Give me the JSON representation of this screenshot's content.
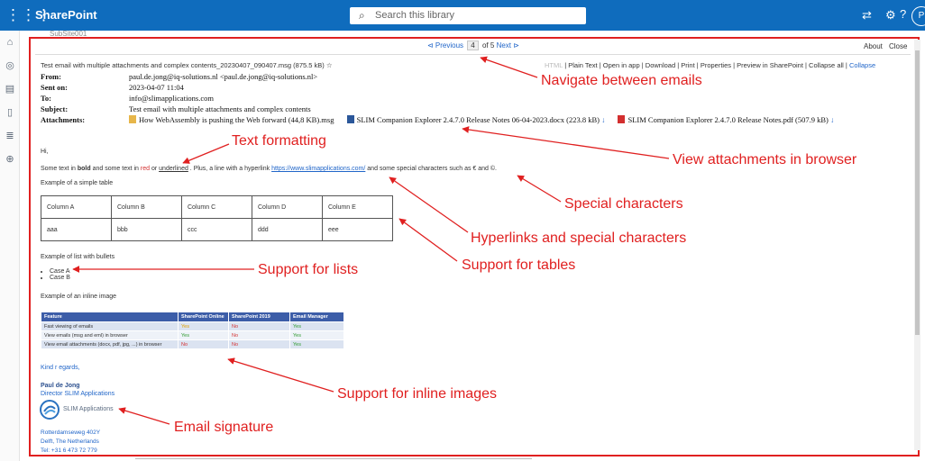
{
  "topbar": {
    "brand": "SharePoint",
    "search_placeholder": "Search this library",
    "avatar_initial": "P"
  },
  "breadcrumb": "SubSite001",
  "nav": {
    "prev": "⊲ Previous",
    "page": "4",
    "of": "of 5",
    "next": "Next ⊳",
    "about": "About",
    "close": "Close"
  },
  "message": {
    "title": "Test email with multiple attachments and complex contents_20230407_090407.msg (875.5 kB)",
    "star": "☆",
    "actions": [
      "HTML",
      "Plain Text",
      "Open in app",
      "Download",
      "Print",
      "Properties",
      "Preview in SharePoint",
      "Collapse all",
      "Collapse"
    ],
    "headers": [
      {
        "label": "From:",
        "value": "paul.de.jong@iq-solutions.nl <paul.de.jong@iq-solutions.nl>"
      },
      {
        "label": "Sent on:",
        "value": "2023-04-07 11:04"
      },
      {
        "label": "To:",
        "value": "info@slimapplications.com"
      },
      {
        "label": "Subject:",
        "value": "Test email with multiple attachments and complex contents"
      },
      {
        "label": "Attachments:",
        "value": ""
      }
    ],
    "attachments": [
      {
        "name": "How WebAssembly is pushing the Web forward (44,8 KB).msg",
        "icon_color": "#e7b64a",
        "download": ""
      },
      {
        "name": "SLIM Companion Explorer 2.4.7.0 Release Notes 06-04-2023.docx (223.8 kB)",
        "icon_color": "#2b579a",
        "download": "↓"
      },
      {
        "name": "SLIM Companion Explorer 2.4.7.0 Release Notes.pdf (507.9 kB)",
        "icon_color": "#d32f2f",
        "download": "↓"
      }
    ]
  },
  "body": {
    "greeting": "Hi,",
    "l1": "Some text in ",
    "l1_bold": "bold",
    "l1_b": " and some text in ",
    "l1_red": "red",
    "l1_c": " or ",
    "l1_ul": "underlined",
    "l1_d": " . Plus, a line with a hyperlink ",
    "l1_link": "https://www.slimapplications.com/",
    "l1_e": " and some special characters such as € and ©.",
    "table_caption": "Example of a simple table",
    "table": [
      [
        "Column A",
        "Column B",
        "Column C",
        "Column D",
        "Column E"
      ],
      [
        "aaa",
        "bbb",
        "ccc",
        "ddd",
        "eee"
      ]
    ],
    "list_caption": "Example of list with bullets",
    "list": [
      "Case A",
      "Case B"
    ],
    "image_caption": "Example of an inline image",
    "img_table": {
      "headers": [
        "Feature",
        "SharePoint Online",
        "SharePoint 2019",
        "Email Manager"
      ],
      "rows": [
        [
          "Fast viewing of emails",
          "Yes",
          "No",
          "Yes"
        ],
        [
          "View emails (msg and eml) in browser",
          "Yes",
          "No",
          "Yes"
        ],
        [
          "View email attachments (docx, pdf, jpg, ...) in browser",
          "No",
          "No",
          "Yes"
        ]
      ]
    },
    "regards": "Kind r egards,",
    "sig_name": "Paul de Jong",
    "sig_title": "Director SLIM Applications",
    "sig_company": "SLIM Applications",
    "address": [
      "Rotterdamseweg 402Y",
      "Delft, The Netherlands",
      "Tel: +31 6 473 72 779"
    ]
  },
  "annotations": {
    "navigate": "Navigate between emails",
    "text_format": "Text formatting",
    "view_att": "View attachments in browser",
    "special": "Special characters",
    "hyperlinks": "Hyperlinks and special characters",
    "lists": "Support for lists",
    "tables": "Support for tables",
    "inline": "Support for inline images",
    "signature": "Email signature"
  },
  "colors": {
    "brand": "#0f6cbd",
    "annotation": "#e02020",
    "link": "#2166c9"
  }
}
